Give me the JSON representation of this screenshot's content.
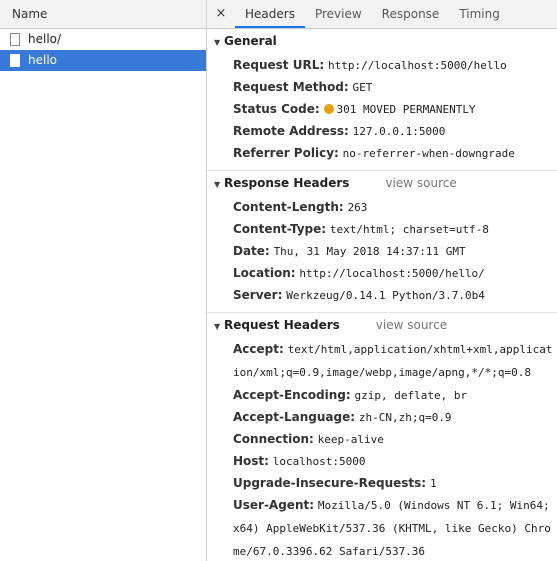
{
  "left": {
    "header": "Name",
    "files": [
      {
        "name": "hello/",
        "selected": false
      },
      {
        "name": "hello",
        "selected": true
      }
    ]
  },
  "tabs": {
    "close": "×",
    "items": [
      "Headers",
      "Preview",
      "Response",
      "Timing"
    ]
  },
  "general": {
    "title": "General",
    "rows": [
      {
        "key": "Request URL:",
        "value": "http://localhost:5000/hello"
      },
      {
        "key": "Request Method:",
        "value": "GET"
      },
      {
        "key": "Status Code:",
        "value": "301 MOVED PERMANENTLY"
      },
      {
        "key": "Remote Address:",
        "value": "127.0.0.1:5000"
      },
      {
        "key": "Referrer Policy:",
        "value": "no-referrer-when-downgrade"
      }
    ]
  },
  "response_headers": {
    "title": "Response Headers",
    "view_source": "view source",
    "rows": [
      {
        "key": "Content-Length:",
        "value": "263"
      },
      {
        "key": "Content-Type:",
        "value": "text/html; charset=utf-8"
      },
      {
        "key": "Date:",
        "value": "Thu, 31 May 2018 14:37:11 GMT"
      },
      {
        "key": "Location:",
        "value": "http://localhost:5000/hello/"
      },
      {
        "key": "Server:",
        "value": "Werkzeug/0.14.1 Python/3.7.0b4"
      }
    ]
  },
  "request_headers": {
    "title": "Request Headers",
    "view_source": "view source",
    "rows": [
      {
        "key": "Accept:",
        "value": "text/html,application/xhtml+xml,application/xml;q=0.9,image/webp,image/apng,*/*;q=0.8"
      },
      {
        "key": "Accept-Encoding:",
        "value": "gzip, deflate, br"
      },
      {
        "key": "Accept-Language:",
        "value": "zh-CN,zh;q=0.9"
      },
      {
        "key": "Connection:",
        "value": "keep-alive"
      },
      {
        "key": "Host:",
        "value": "localhost:5000"
      },
      {
        "key": "Upgrade-Insecure-Requests:",
        "value": "1"
      },
      {
        "key": "User-Agent:",
        "value": "Mozilla/5.0 (Windows NT 6.1; Win64; x64) AppleWebKit/537.36 (KHTML, like Gecko) Chrome/67.0.3396.62 Safari/537.36"
      }
    ]
  },
  "colors": {
    "selected_row": "#3879d9",
    "status_dot": "#e6a100",
    "active_tab": "#1a73e8"
  }
}
